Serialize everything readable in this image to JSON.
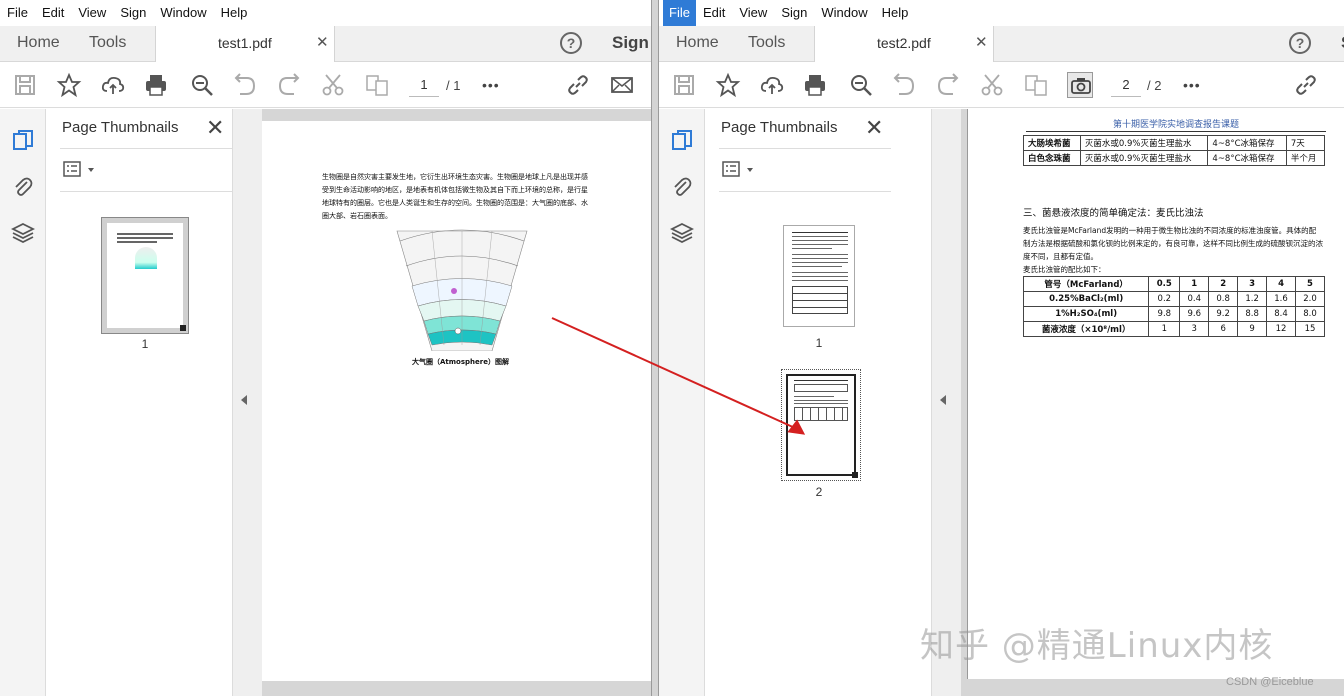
{
  "menu": [
    "File",
    "Edit",
    "View",
    "Sign",
    "Window",
    "Help"
  ],
  "nav": {
    "home": "Home",
    "tools": "Tools",
    "sign": "Sign"
  },
  "help_icon": "?",
  "close_glyph": "✕",
  "more_glyph": "•••",
  "left_window": {
    "doc_tab": "test1.pdf",
    "page_current": "1",
    "page_total": "/ 1",
    "thumb_title": "Page Thumbnails",
    "thumbs": [
      "1"
    ],
    "doc": {
      "paragraph": "生物圈是自然灾害主要发生地，它衍生出环境生态灾害。生物圈是地球上凡是出现并感受到生命活动影响的地区，是地表有机体包括微生物及其自下而上环境的总称，是行星地球特有的圈层。它也是人类诞生和生存的空间。生物圈的范围是：大气圈的底部、水圈大部、岩石圈表面。",
      "caption": "大气圈（Atmosphere）图解"
    }
  },
  "right_window": {
    "doc_tab": "test2.pdf",
    "page_current": "2",
    "page_total": "/ 2",
    "thumb_title": "Page Thumbnails",
    "thumbs": [
      "1",
      "2"
    ],
    "doc": {
      "header": "第十期医学院实地调查报告课题",
      "table1": [
        [
          "大肠埃希菌",
          "灭菌水或0.9%灭菌生理盐水",
          "4~8°C冰箱保存",
          "7天"
        ],
        [
          "白色念珠菌",
          "灭菌水或0.9%灭菌生理盐水",
          "4~8°C冰箱保存",
          "半个月"
        ]
      ],
      "section": "三、菌悬液浓度的简单确定法：麦氏比浊法",
      "para": "麦氏比浊管是McFarland发明的一种用于微生物比浊的不同浓度的标准浊度管。具体的配制方法是根据硫酸和氯化钡的比例来定的，有良可靠，这样不同比例生成的硫酸钡沉淀的浓度不同，且都有定值。",
      "table_intro": "麦氏比浊管的配比如下：",
      "mcfarland": {
        "header": [
          "管号（McFarland）",
          "0.5",
          "1",
          "2",
          "3",
          "4",
          "5"
        ],
        "rows": [
          [
            "0.25%BaCl₂(ml)",
            "0.2",
            "0.4",
            "0.8",
            "1.2",
            "1.6",
            "2.0"
          ],
          [
            "1%H₂SO₄(ml)",
            "9.8",
            "9.6",
            "9.2",
            "8.8",
            "8.4",
            "8.0"
          ],
          [
            "菌液浓度（×10⁸/ml）",
            "1",
            "3",
            "6",
            "9",
            "12",
            "15"
          ]
        ]
      }
    }
  },
  "watermark": "知乎 @精通Linux内核",
  "credit": "CSDN @Eiceblue",
  "colors": {
    "accent": "#2f7bd6",
    "arrow": "#d42020"
  }
}
